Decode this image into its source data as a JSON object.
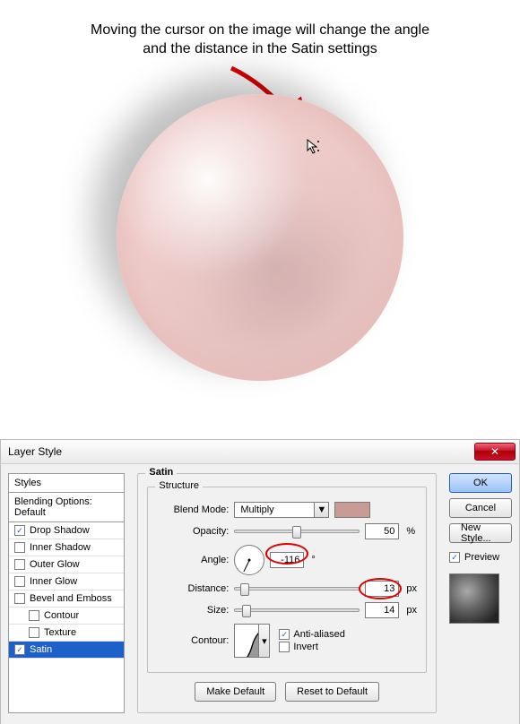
{
  "caption_line1": "Moving the cursor on the image will change the angle",
  "caption_line2": "and the distance in the Satin settings",
  "dialog": {
    "title": "Layer Style",
    "close_glyph": "✕",
    "styles_header": "Styles",
    "blending_options": "Blending Options: Default",
    "style_items": [
      {
        "label": "Drop Shadow",
        "checked": true
      },
      {
        "label": "Inner Shadow",
        "checked": false
      },
      {
        "label": "Outer Glow",
        "checked": false
      },
      {
        "label": "Inner Glow",
        "checked": false
      },
      {
        "label": "Bevel and Emboss",
        "checked": false
      },
      {
        "label": "Contour",
        "checked": false,
        "indent": true
      },
      {
        "label": "Texture",
        "checked": false,
        "indent": true
      },
      {
        "label": "Satin",
        "checked": true,
        "selected": true
      }
    ],
    "satin": {
      "group_title": "Satin",
      "structure_title": "Structure",
      "blend_mode_label": "Blend Mode:",
      "blend_mode_value": "Multiply",
      "swatch_color": "#c89b97",
      "opacity_label": "Opacity:",
      "opacity_value": "50",
      "percent": "%",
      "angle_label": "Angle:",
      "angle_value": "-116",
      "degree": "°",
      "distance_label": "Distance:",
      "distance_value": "13",
      "px": "px",
      "size_label": "Size:",
      "size_value": "14",
      "contour_label": "Contour:",
      "anti_aliased_label": "Anti-aliased",
      "invert_label": "Invert",
      "make_default": "Make Default",
      "reset_default": "Reset to Default"
    },
    "buttons": {
      "ok": "OK",
      "cancel": "Cancel",
      "new_style": "New Style...",
      "preview": "Preview"
    }
  }
}
